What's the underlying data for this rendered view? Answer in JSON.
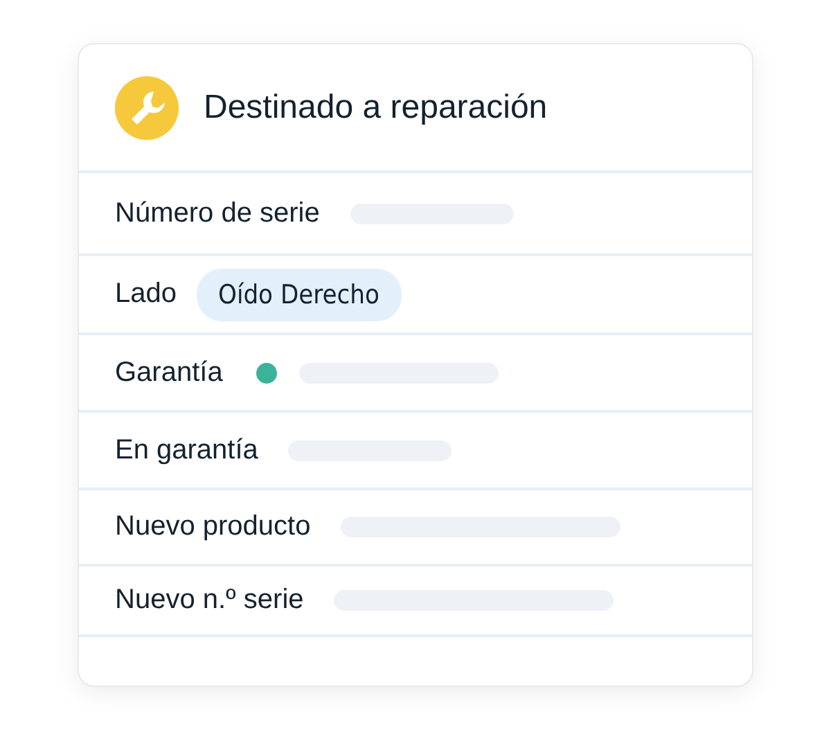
{
  "card": {
    "title": "Destinado a reparación",
    "rows": [
      {
        "label": "Número de serie",
        "kind": "placeholder"
      },
      {
        "label": "Lado",
        "kind": "tag",
        "value": "Oído Derecho"
      },
      {
        "label": "Garantía",
        "kind": "status",
        "color": "#3bb39a"
      },
      {
        "label": "En garantía",
        "kind": "placeholder"
      },
      {
        "label": "Nuevo producto",
        "kind": "placeholder"
      },
      {
        "label": "Nuevo n.º serie",
        "kind": "placeholder"
      }
    ]
  }
}
